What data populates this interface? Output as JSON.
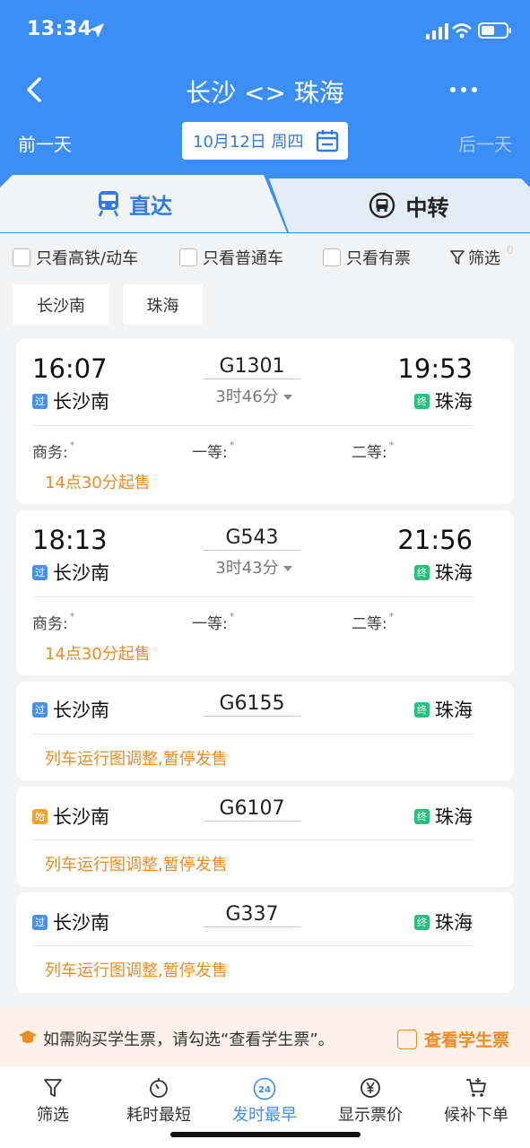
{
  "status_bar": {
    "time": "13:34"
  },
  "nav": {
    "title": "长沙 <> 珠海"
  },
  "date_bar": {
    "prev_label": "前一天",
    "date": "10月12日 周四",
    "next_label": "后一天"
  },
  "tabs": {
    "direct": "直达",
    "transfer": "中转"
  },
  "filters": {
    "high_speed": "只看高铁/动车",
    "normal": "只看普通车",
    "available": "只看有票",
    "filter": "筛选",
    "filter_count": "0"
  },
  "station_chips": {
    "from": "长沙南",
    "to": "珠海"
  },
  "trains": [
    {
      "dep_time": "16:07",
      "arr_time": "19:53",
      "from_tag": "过",
      "from": "长沙南",
      "to_tag": "终",
      "to": "珠海",
      "train_no": "G1301",
      "duration": "3时46分",
      "seats": [
        {
          "label": "商务:",
          "mark": "*"
        },
        {
          "label": "一等:",
          "mark": "*"
        },
        {
          "label": "二等:",
          "mark": "*"
        }
      ],
      "status": "14点30分起售"
    },
    {
      "dep_time": "18:13",
      "arr_time": "21:56",
      "from_tag": "过",
      "from": "长沙南",
      "to_tag": "终",
      "to": "珠海",
      "train_no": "G543",
      "duration": "3时43分",
      "seats": [
        {
          "label": "商务:",
          "mark": "*"
        },
        {
          "label": "一等:",
          "mark": "*"
        },
        {
          "label": "二等:",
          "mark": "*"
        }
      ],
      "status": "14点30分起售"
    },
    {
      "from_tag": "过",
      "from": "长沙南",
      "to_tag": "终",
      "to": "珠海",
      "train_no": "G6155",
      "status": "列车运行图调整,暂停发售"
    },
    {
      "from_tag": "始",
      "from": "长沙南",
      "to_tag": "终",
      "to": "珠海",
      "train_no": "G6107",
      "status": "列车运行图调整,暂停发售"
    },
    {
      "from_tag": "过",
      "from": "长沙南",
      "to_tag": "终",
      "to": "珠海",
      "train_no": "G337",
      "status": "列车运行图调整,暂停发售"
    }
  ],
  "student": {
    "text": "如需购买学生票，请勾选“查看学生票”。",
    "checkbox_label": "查看学生票"
  },
  "bottom_bar": {
    "filter": "筛选",
    "shortest": "耗时最短",
    "earliest": "发时最早",
    "earliest_badge": "24",
    "price": "显示票价",
    "waitlist": "候补下单"
  },
  "colors": {
    "primary": "#3a8ef6",
    "orange": "#ee8b22",
    "green_tag": "#29bf7c",
    "blue_tag": "#4a90e8",
    "orange_tag": "#f4a22c"
  }
}
